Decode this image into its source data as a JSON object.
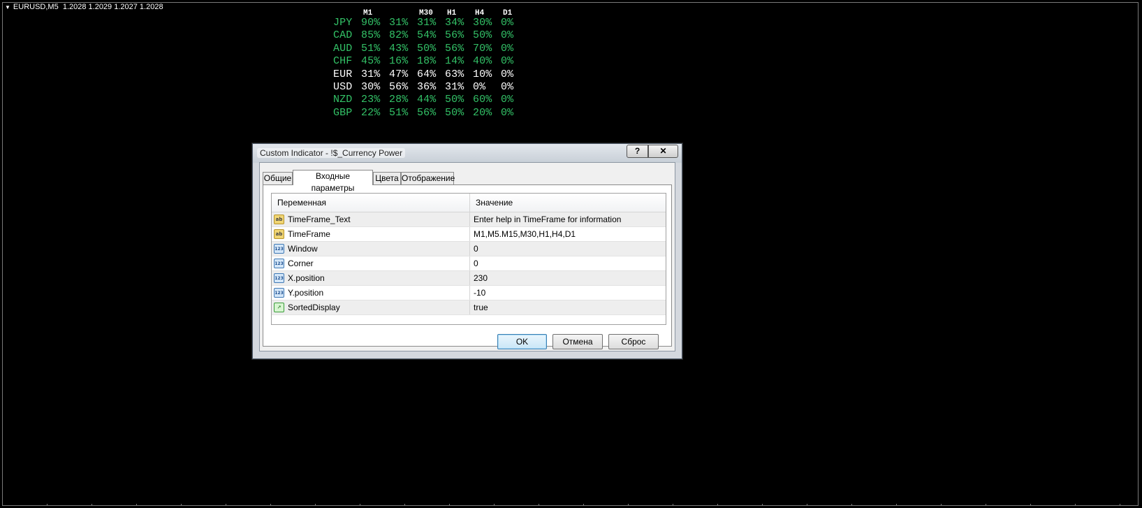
{
  "chart": {
    "symbol_label": "EURUSD,M5  1.2028 1.2029 1.2027 1.2028"
  },
  "indicator": {
    "header": [
      "M1",
      "M30",
      "H1",
      "H4",
      "D1"
    ],
    "rows": [
      {
        "code": "JPY",
        "vals": [
          "90%",
          "31%",
          "31%",
          "34%",
          "30%",
          "0%"
        ],
        "color": "#33c267"
      },
      {
        "code": "CAD",
        "vals": [
          "85%",
          "82%",
          "54%",
          "56%",
          "50%",
          "0%"
        ],
        "color": "#33c267"
      },
      {
        "code": "AUD",
        "vals": [
          "51%",
          "43%",
          "50%",
          "56%",
          "70%",
          "0%"
        ],
        "color": "#33c267"
      },
      {
        "code": "CHF",
        "vals": [
          "45%",
          "16%",
          "18%",
          "14%",
          "40%",
          "0%"
        ],
        "color": "#33c267"
      },
      {
        "code": "EUR",
        "vals": [
          "31%",
          "47%",
          "64%",
          "63%",
          "10%",
          "0%"
        ],
        "color": "#ffffff"
      },
      {
        "code": "USD",
        "vals": [
          "30%",
          "56%",
          "36%",
          "31%",
          "0%",
          "0%"
        ],
        "color": "#ffffff"
      },
      {
        "code": "NZD",
        "vals": [
          "23%",
          "28%",
          "44%",
          "50%",
          "60%",
          "0%"
        ],
        "color": "#33c267"
      },
      {
        "code": "GBP",
        "vals": [
          "22%",
          "51%",
          "56%",
          "50%",
          "20%",
          "0%"
        ],
        "color": "#33c267"
      }
    ]
  },
  "dialog": {
    "title": "Custom Indicator - !$_Currency Power",
    "help_label": "?",
    "close_label": "✕",
    "tabs": [
      "Общие",
      "Входные параметры",
      "Цвета",
      "Отображение"
    ],
    "columns": {
      "variable": "Переменная",
      "value": "Значение"
    },
    "params": [
      {
        "icon": "ab",
        "name": "TimeFrame_Text",
        "value": "Enter help in TimeFrame for information"
      },
      {
        "icon": "ab",
        "name": "TimeFrame",
        "value": "M1,M5.M15,M30,H1,H4,D1"
      },
      {
        "icon": "123",
        "name": "Window",
        "value": "0"
      },
      {
        "icon": "123",
        "name": "Corner",
        "value": "0"
      },
      {
        "icon": "123",
        "name": "X.position",
        "value": "230"
      },
      {
        "icon": "123",
        "name": "Y.position",
        "value": "-10"
      },
      {
        "icon": "bool",
        "name": "SortedDisplay",
        "value": "true"
      }
    ],
    "buttons": {
      "ok": "OK",
      "cancel": "Отмена",
      "reset": "Сброс"
    }
  }
}
